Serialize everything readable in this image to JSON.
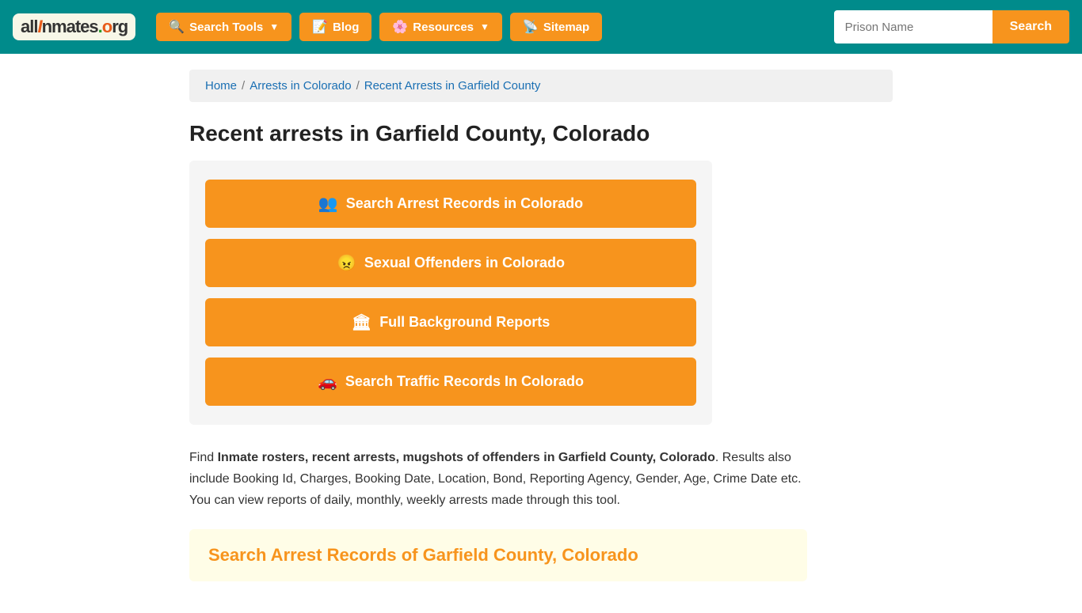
{
  "navbar": {
    "logo": {
      "text": "allInmates.org",
      "display": "all🔎nmates.🌎rg"
    },
    "nav_items": [
      {
        "label": "Search Tools",
        "icon": "🔍",
        "has_dropdown": true
      },
      {
        "label": "Blog",
        "icon": "📝",
        "has_dropdown": false
      },
      {
        "label": "Resources",
        "icon": "🌸",
        "has_dropdown": true
      },
      {
        "label": "Sitemap",
        "icon": "📡",
        "has_dropdown": false
      }
    ],
    "search": {
      "placeholder": "Prison Name",
      "button_label": "Search"
    }
  },
  "breadcrumb": {
    "items": [
      {
        "label": "Home",
        "link": true
      },
      {
        "label": "Arrests in Colorado",
        "link": true
      },
      {
        "label": "Recent Arrests in Garfield County",
        "link": false
      }
    ]
  },
  "page": {
    "title": "Recent arrests in Garfield County, Colorado",
    "buttons": [
      {
        "label": "Search Arrest Records in Colorado",
        "icon": "👥"
      },
      {
        "label": "Sexual Offenders in Colorado",
        "icon": "😠"
      },
      {
        "label": "Full Background Reports",
        "icon": "🏛"
      },
      {
        "label": "Search Traffic Records In Colorado",
        "icon": "🚗"
      }
    ],
    "description_intro": "Find ",
    "description_bold": "Inmate rosters, recent arrests, mugshots of offenders in Garfield County, Colorado",
    "description_rest": ". Results also include Booking Id, Charges, Booking Date, Location, Bond, Reporting Agency, Gender, Age, Crime Date etc. You can view reports of daily, monthly, weekly arrests made through this tool.",
    "search_section_title": "Search Arrest Records of Garfield County, Colorado"
  }
}
